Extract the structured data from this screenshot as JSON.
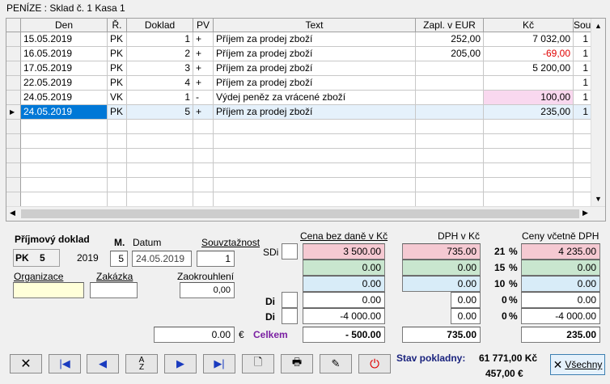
{
  "window": {
    "title": "PENÍZE : Sklad č. 1 Kasa 1"
  },
  "grid": {
    "columns": [
      "Den",
      "Ř.",
      "Doklad",
      "PV",
      "Text",
      "Zapl. v EUR",
      "Kč",
      "Souv."
    ],
    "rows": [
      {
        "den": "15.05.2019",
        "r": "PK",
        "doklad": "1",
        "pv": "+",
        "text": "Příjem za prodej zboží",
        "eur": "252,00",
        "kc": "7 032,00",
        "souv": "1",
        "kc_color": "#000000"
      },
      {
        "den": "16.05.2019",
        "r": "PK",
        "doklad": "2",
        "pv": "+",
        "text": "Příjem za prodej zboží",
        "eur": "205,00",
        "kc": "-69,00",
        "souv": "1",
        "kc_color": "#e00000"
      },
      {
        "den": "17.05.2019",
        "r": "PK",
        "doklad": "3",
        "pv": "+",
        "text": "Příjem za prodej zboží",
        "eur": "",
        "kc": "5 200,00",
        "souv": "1",
        "kc_color": "#000000"
      },
      {
        "den": "22.05.2019",
        "r": "PK",
        "doklad": "4",
        "pv": "+",
        "text": "Příjem za prodej zboží",
        "eur": "",
        "kc": "",
        "souv": "1",
        "kc_color": "#000000"
      },
      {
        "den": "24.05.2019",
        "r": "VK",
        "doklad": "1",
        "pv": "-",
        "text": "Výdej peněz za vrácené zboží",
        "eur": "",
        "kc": "100,00",
        "souv": "1",
        "kc_color": "#000000"
      },
      {
        "den": "24.05.2019",
        "r": "PK",
        "doklad": "5",
        "pv": "+",
        "text": "Příjem za prodej zboží",
        "eur": "",
        "kc": "235,00",
        "souv": "1",
        "kc_color": "#000000"
      }
    ]
  },
  "form": {
    "doc_type_label": "Příjmový doklad",
    "doc_code": "PK",
    "doc_number": "5",
    "year": "2019",
    "m_label": "M.",
    "m_value": "5",
    "datum_label": "Datum",
    "datum_value": "24.05.2019",
    "souvztaznost_label": "Souvztažnost",
    "souvztaznost_value": "1",
    "organizace_label": "Organizace",
    "organizace_value": "",
    "zakazka_label": "Zakázka",
    "zakazka_value": "",
    "zaokrouhleni_label": "Zaokrouhlení",
    "zaokrouhleni_value": "0,00",
    "eur_value": "0.00",
    "eur_symbol": "€",
    "celkem_label": "Celkem"
  },
  "totals": {
    "col_headers": {
      "base": "Cena bez daně v Kč",
      "vat": "DPH v Kč",
      "gross": "Ceny včetně DPH"
    },
    "sdi_label": "SDi",
    "di_label": "Di",
    "rows": [
      {
        "base": "3 500.00",
        "vat": "735.00",
        "rate": "21",
        "gross": "4 235.00"
      },
      {
        "base": "0.00",
        "vat": "0.00",
        "rate": "15",
        "gross": "0.00"
      },
      {
        "base": "0.00",
        "vat": "0.00",
        "rate": "10",
        "gross": "0.00"
      },
      {
        "base": "0.00",
        "vat": "0.00",
        "rate": "0",
        "gross": "0.00"
      },
      {
        "base": "-4 000.00",
        "vat": "0.00",
        "rate": "0",
        "gross": "-4 000.00"
      }
    ],
    "pct": "%",
    "total_base": "- 500.00",
    "total_vat": "735.00",
    "total_gross": "235.00"
  },
  "status": {
    "label": "Stav pokladny:",
    "kc": "61 771,00 Kč",
    "eur": "457,00 €"
  },
  "toolbar": {
    "all_label": "Všechny"
  }
}
